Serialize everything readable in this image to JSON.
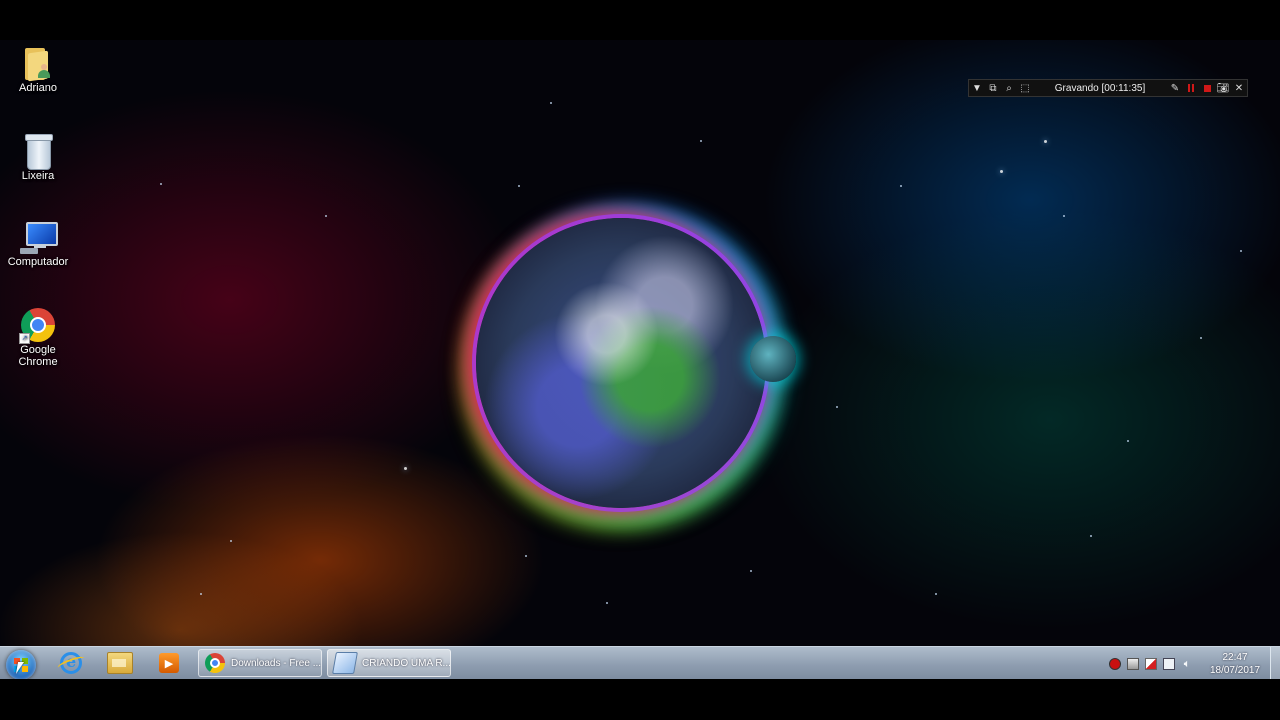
{
  "desktop": {
    "icons": [
      {
        "label": "Adriano",
        "icon": "user-folder-icon"
      },
      {
        "label": "Lixeira",
        "icon": "recycle-bin-icon"
      },
      {
        "label": "Computador",
        "icon": "computer-icon"
      },
      {
        "label": "Google Chrome",
        "icon": "chrome-icon"
      }
    ]
  },
  "recorder": {
    "title": "Gravando [00:11:35]",
    "buttons": [
      "dropdown-icon",
      "window-icon",
      "zoom-icon",
      "region-icon",
      "pen-icon",
      "pause-icon",
      "stop-icon",
      "camera-icon",
      "close-icon"
    ],
    "accent": "#d01818"
  },
  "taskbar": {
    "start": "windows-start-icon",
    "pinned": [
      "internet-explorer-icon",
      "file-explorer-icon",
      "media-player-icon"
    ],
    "tasks": [
      {
        "label": "Downloads - Free ...",
        "icon": "chrome-icon"
      },
      {
        "label": "CRIANDO UMA R...",
        "icon": "document-icon"
      }
    ],
    "tray": [
      "record-icon",
      "network-icon",
      "flag-icon",
      "monitor-icon",
      "volume-icon"
    ],
    "clock": {
      "time": "22:47",
      "date": "18/07/2017"
    }
  }
}
